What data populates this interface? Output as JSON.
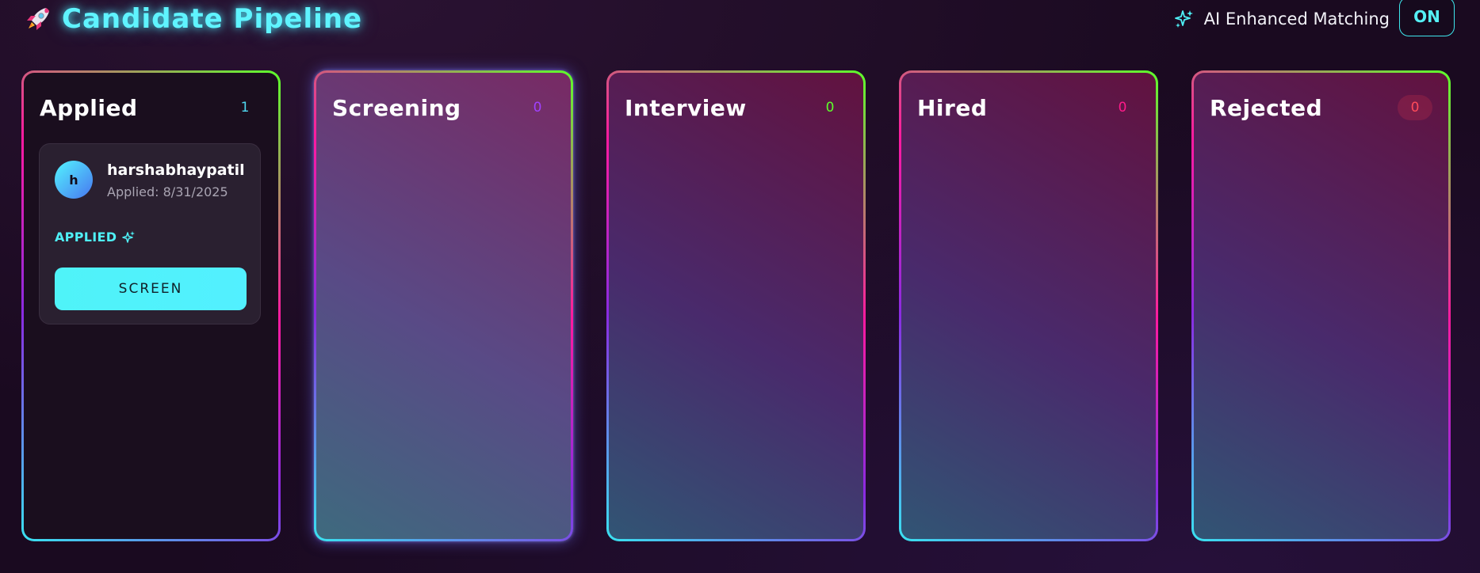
{
  "header": {
    "title": "Candidate Pipeline",
    "title_icon": "rocket-icon",
    "ai_label": "AI Enhanced Matching",
    "ai_icon": "sparkle-icon",
    "ai_toggle": "ON"
  },
  "columns": [
    {
      "title": "Applied",
      "count": "1",
      "count_color": "#4fd8f0"
    },
    {
      "title": "Screening",
      "count": "0",
      "count_color": "#a040ff"
    },
    {
      "title": "Interview",
      "count": "0",
      "count_color": "#5cff2a"
    },
    {
      "title": "Hired",
      "count": "0",
      "count_color": "#ff1a8a"
    },
    {
      "title": "Rejected",
      "count": "0",
      "count_color": "#ff4a5a"
    }
  ],
  "candidate": {
    "initial": "h",
    "name": "harshabhaypatil",
    "applied": "Applied: 8/31/2025",
    "status": "APPLIED",
    "action": "SCREEN"
  },
  "colors": {
    "accent_cyan": "#55f0f5",
    "background": "#1a0a20"
  }
}
